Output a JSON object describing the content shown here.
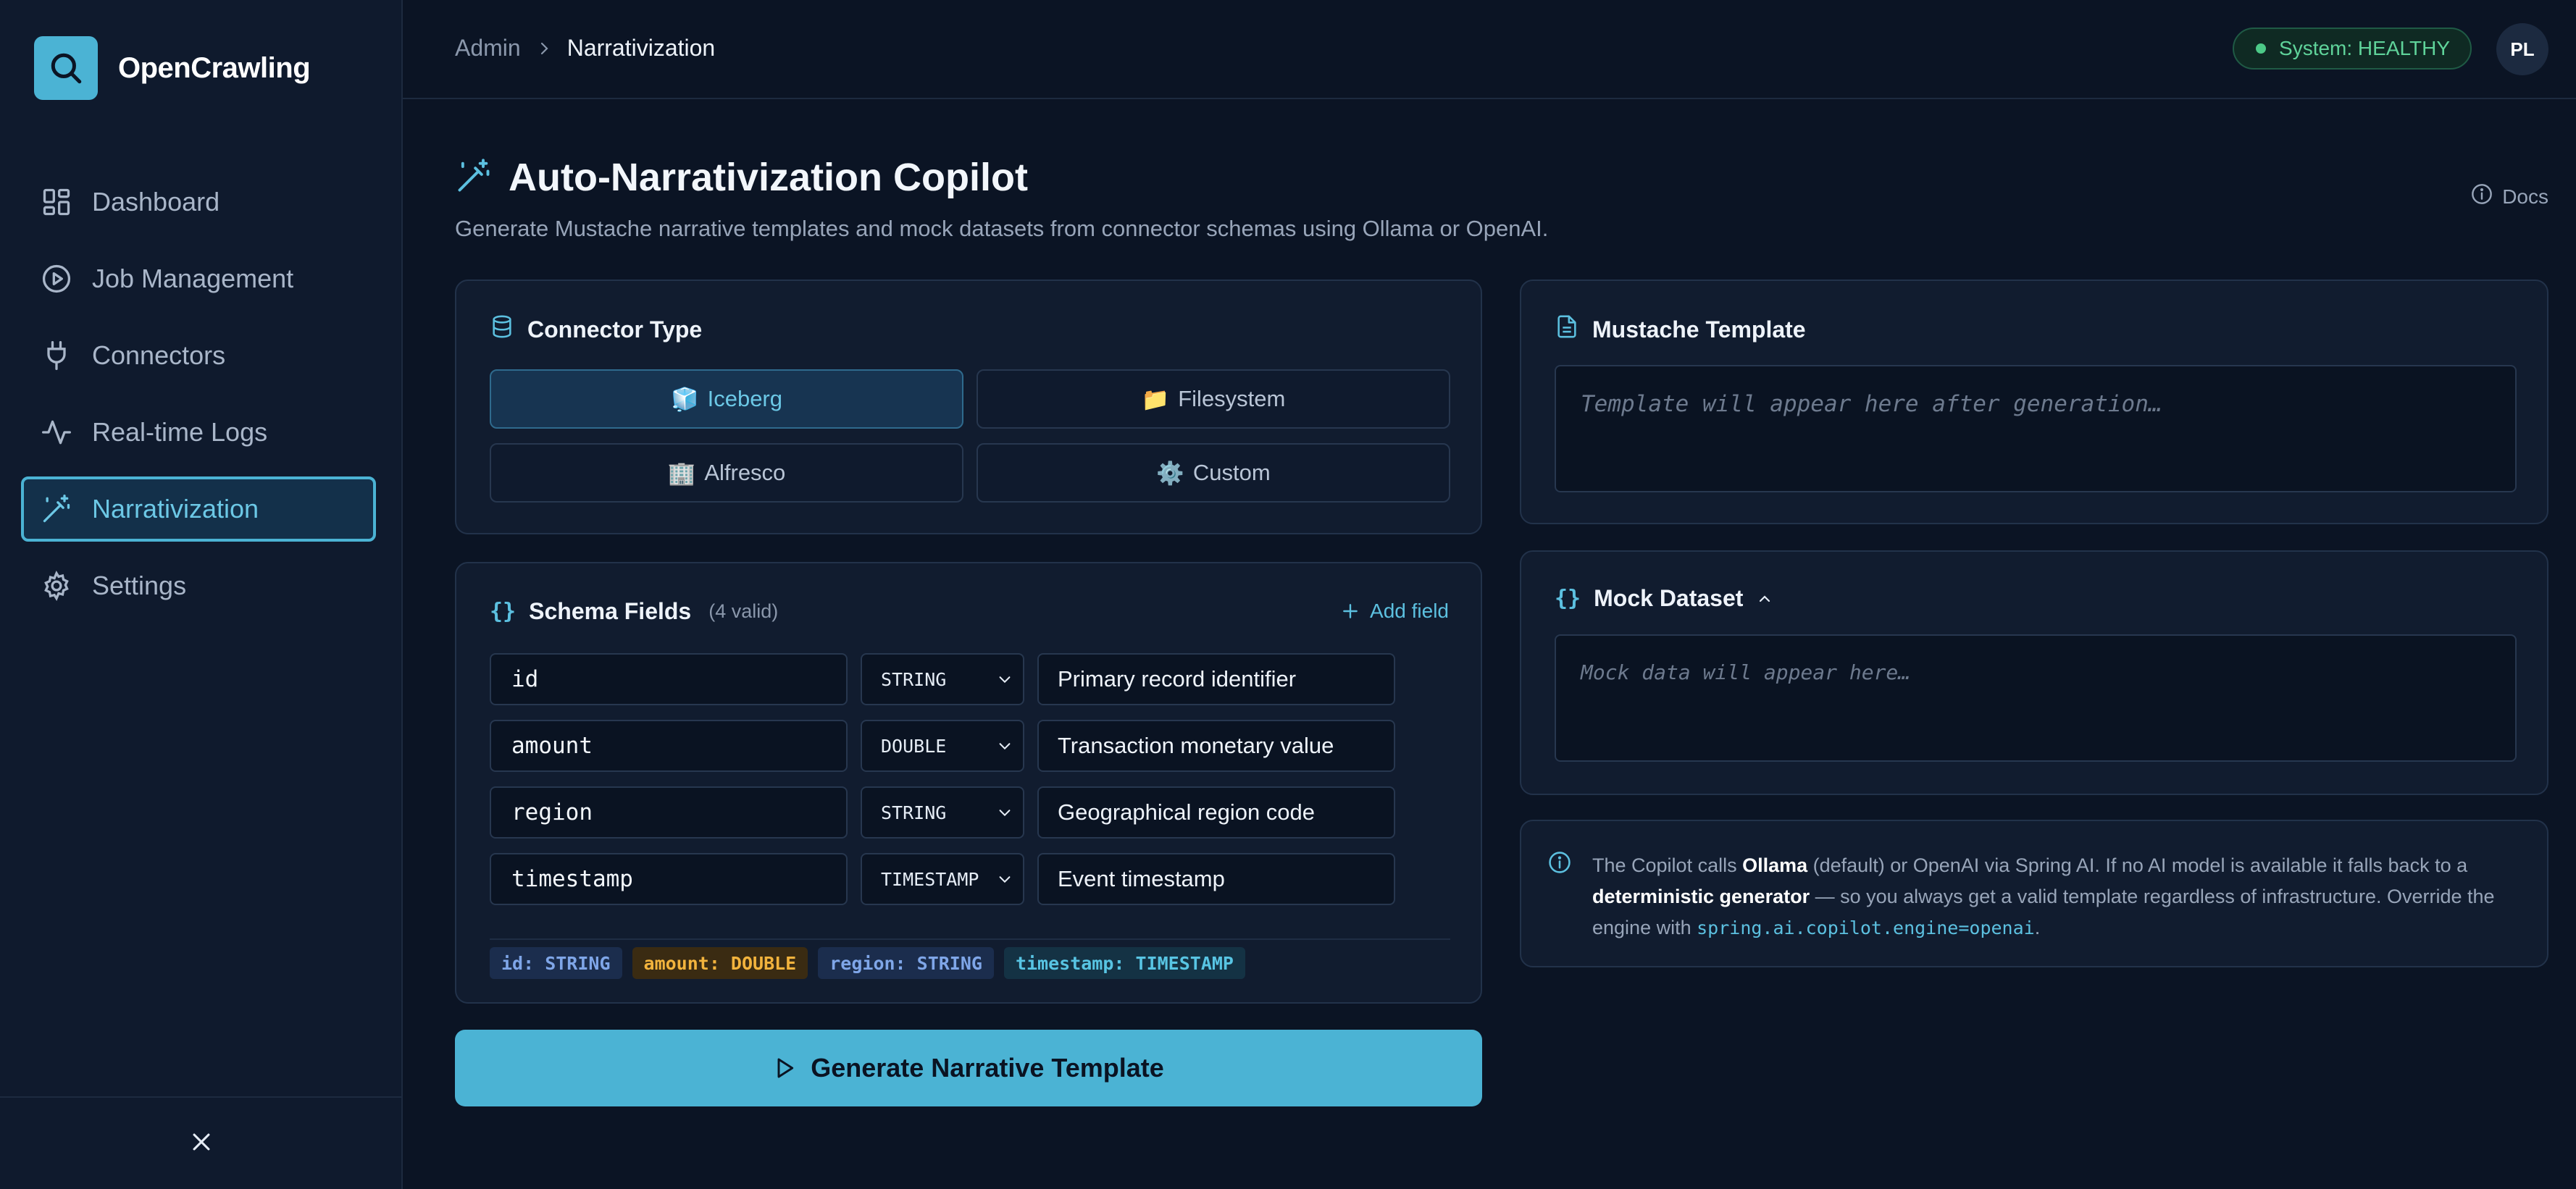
{
  "app": {
    "name": "OpenCrawling"
  },
  "sidebar": {
    "items": [
      {
        "label": "Dashboard",
        "icon": "dashboard-icon"
      },
      {
        "label": "Job Management",
        "icon": "play-circle-icon"
      },
      {
        "label": "Connectors",
        "icon": "plug-icon"
      },
      {
        "label": "Real-time Logs",
        "icon": "activity-icon"
      },
      {
        "label": "Narrativization",
        "icon": "magic-wand-icon",
        "active": true
      },
      {
        "label": "Settings",
        "icon": "gear-icon"
      }
    ]
  },
  "header": {
    "breadcrumb": {
      "root": "Admin",
      "current": "Narrativization"
    },
    "status": "System: HEALTHY",
    "avatar": "PL"
  },
  "page": {
    "title": "Auto-Narrativization Copilot",
    "subtitle": "Generate Mustache narrative templates and mock datasets from connector schemas using Ollama or OpenAI.",
    "docs_label": "Docs"
  },
  "connector": {
    "title": "Connector Type",
    "options": [
      {
        "emoji": "🧊",
        "label": "Iceberg",
        "selected": true
      },
      {
        "emoji": "📁",
        "label": "Filesystem"
      },
      {
        "emoji": "🏢",
        "label": "Alfresco"
      },
      {
        "emoji": "⚙️",
        "label": "Custom"
      }
    ]
  },
  "schema": {
    "title": "Schema Fields",
    "count": "(4 valid)",
    "add_label": "Add field",
    "fields": [
      {
        "name": "id",
        "type": "STRING",
        "description": "Primary record identifier"
      },
      {
        "name": "amount",
        "type": "DOUBLE",
        "description": "Transaction monetary value"
      },
      {
        "name": "region",
        "type": "STRING",
        "description": "Geographical region code"
      },
      {
        "name": "timestamp",
        "type": "TIMESTAMP",
        "description": "Event timestamp"
      }
    ],
    "chips": [
      "id: STRING",
      "amount: DOUBLE",
      "region: STRING",
      "timestamp: TIMESTAMP"
    ]
  },
  "generate": {
    "label": "Generate Narrative Template"
  },
  "template": {
    "title": "Mustache Template",
    "placeholder": "Template will appear here after generation…"
  },
  "mock": {
    "title": "Mock Dataset",
    "placeholder": "Mock data will appear here…"
  },
  "info": {
    "p1": "The Copilot calls ",
    "b1": "Ollama",
    "p2": " (default) or OpenAI via Spring AI. If no AI model is available it falls back to a ",
    "b2": "deterministic generator",
    "p3": " — so you always get a valid template regardless of infrastructure. Override the engine with ",
    "code": "spring.ai.copilot.engine=openai",
    "p4": "."
  },
  "colors": {
    "accent": "#4bb3d4",
    "background": "#0b1424",
    "healthy": "#4cc987",
    "amber": "#f2b33d"
  }
}
